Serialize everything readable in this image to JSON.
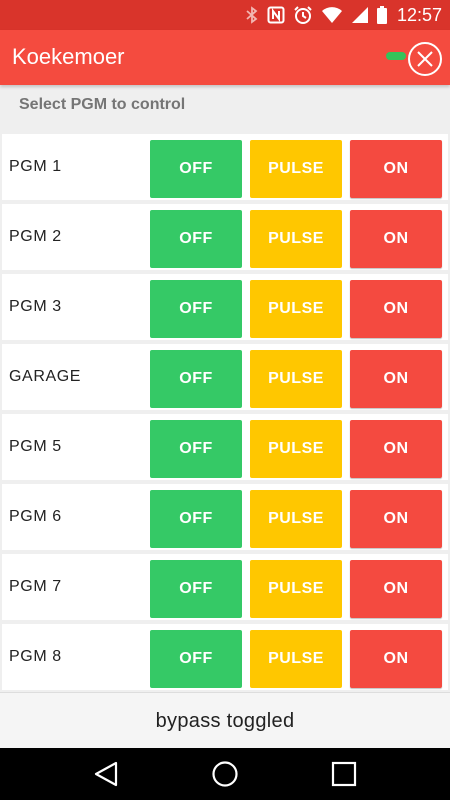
{
  "status_bar": {
    "time": "12:57",
    "icons": [
      "bluetooth-icon",
      "nfc-icon",
      "alarm-icon",
      "wifi-icon",
      "signal-icon",
      "battery-icon"
    ]
  },
  "app_bar": {
    "title": "Koekemoer",
    "connection_status_color": "#34c35a",
    "close_icon": "close-icon"
  },
  "subtitle": "Select PGM to control",
  "pgm_rows": [
    {
      "label": "PGM 1",
      "off": "OFF",
      "pulse": "PULSE",
      "on": "ON"
    },
    {
      "label": "PGM 2",
      "off": "OFF",
      "pulse": "PULSE",
      "on": "ON"
    },
    {
      "label": "PGM 3",
      "off": "OFF",
      "pulse": "PULSE",
      "on": "ON"
    },
    {
      "label": "GARAGE",
      "off": "OFF",
      "pulse": "PULSE",
      "on": "ON"
    },
    {
      "label": "PGM 5",
      "off": "OFF",
      "pulse": "PULSE",
      "on": "ON"
    },
    {
      "label": "PGM 6",
      "off": "OFF",
      "pulse": "PULSE",
      "on": "ON"
    },
    {
      "label": "PGM 7",
      "off": "OFF",
      "pulse": "PULSE",
      "on": "ON"
    },
    {
      "label": "PGM 8",
      "off": "OFF",
      "pulse": "PULSE",
      "on": "ON"
    }
  ],
  "colors": {
    "app_bar": "#f44b3f",
    "status_bar": "#d9342b",
    "off": "#35c966",
    "pulse": "#ffc700",
    "on": "#f44a40"
  },
  "toast": "bypass toggled",
  "nav_bar": [
    "back-icon",
    "home-icon",
    "recents-icon"
  ]
}
